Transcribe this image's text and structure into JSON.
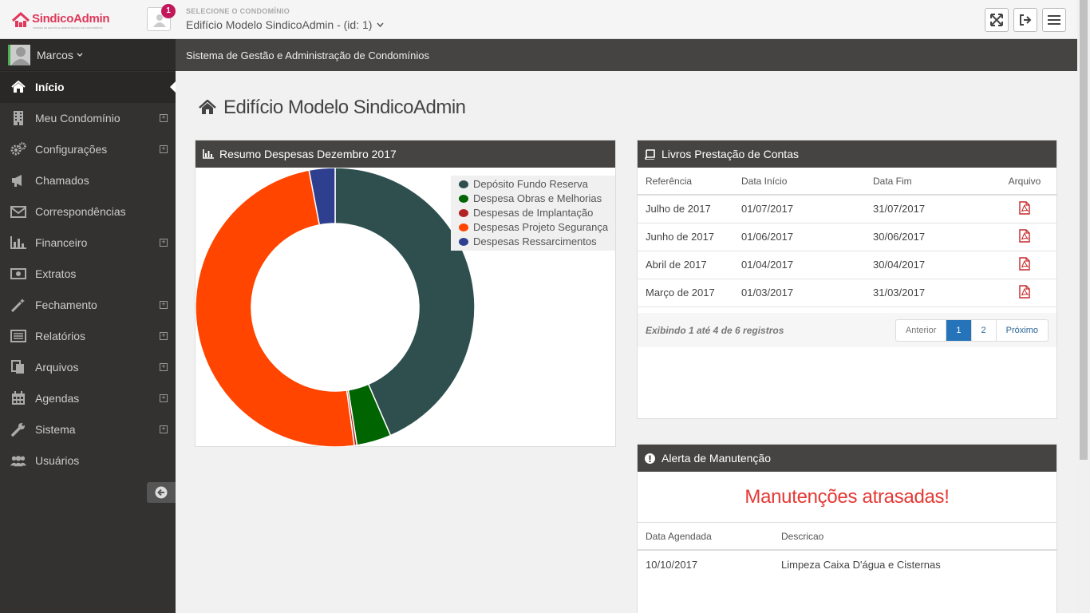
{
  "header": {
    "logo_text": "SindicoAdmin",
    "logo_sub": "SISTEMA DE GESTÃO E ADMINISTRAÇÃO DE CONDOMÍNIOS",
    "notification_count": "1",
    "condo_label": "SELECIONE O CONDOMÍNIO",
    "condo_value": "Edifício Modelo SindicoAdmin - (id: 1)",
    "buttons": [
      "fullscreen-icon",
      "logout-icon",
      "menu-icon"
    ]
  },
  "user": {
    "name": "Marcos"
  },
  "sidebar": {
    "items": [
      {
        "label": "Início",
        "icon": "home-icon",
        "active": true,
        "expandable": false
      },
      {
        "label": "Meu Condomínio",
        "icon": "building-icon",
        "active": false,
        "expandable": true
      },
      {
        "label": "Configurações",
        "icon": "cogs-icon",
        "active": false,
        "expandable": true
      },
      {
        "label": "Chamados",
        "icon": "megaphone-icon",
        "active": false,
        "expandable": false
      },
      {
        "label": "Correspondências",
        "icon": "envelope-icon",
        "active": false,
        "expandable": false
      },
      {
        "label": "Financeiro",
        "icon": "bar-chart-icon",
        "active": false,
        "expandable": true
      },
      {
        "label": "Extratos",
        "icon": "money-icon",
        "active": false,
        "expandable": false
      },
      {
        "label": "Fechamento",
        "icon": "magic-wand-icon",
        "active": false,
        "expandable": true
      },
      {
        "label": "Relatórios",
        "icon": "list-icon",
        "active": false,
        "expandable": true
      },
      {
        "label": "Arquivos",
        "icon": "files-icon",
        "active": false,
        "expandable": true
      },
      {
        "label": "Agendas",
        "icon": "calendar-icon",
        "active": false,
        "expandable": true
      },
      {
        "label": "Sistema",
        "icon": "wrench-icon",
        "active": false,
        "expandable": true
      },
      {
        "label": "Usuários",
        "icon": "users-icon",
        "active": false,
        "expandable": false
      }
    ]
  },
  "breadcrumb": {
    "text": "Sistema de Gestão e Administração de Condomínios"
  },
  "page": {
    "title": "Edifício Modelo SindicoAdmin"
  },
  "expenses_panel": {
    "title": "Resumo Despesas Dezembro 2017"
  },
  "chart_data": {
    "type": "pie",
    "categories": [
      "Depósito Fundo Reserva",
      "Despesa Obras e Melhorias",
      "Despesas de Implantação",
      "Despesas Projeto Segurança",
      "Despesas Ressarcimentos"
    ],
    "values": [
      43.5,
      4.0,
      0.3,
      49.2,
      3.0
    ],
    "colors": [
      "#2f4f4f",
      "#006400",
      "#b22222",
      "#ff4500",
      "#2e3f8f"
    ],
    "legend_position": "top-right"
  },
  "books_panel": {
    "title": "Livros Prestação de Contas",
    "columns": [
      "Referência",
      "Data Início",
      "Data Fim",
      "Arquivo"
    ],
    "rows": [
      [
        "Julho de 2017",
        "01/07/2017",
        "31/07/2017"
      ],
      [
        "Junho de 2017",
        "01/06/2017",
        "30/06/2017"
      ],
      [
        "Abril de 2017",
        "01/04/2017",
        "30/04/2017"
      ],
      [
        "Março de 2017",
        "01/03/2017",
        "31/03/2017"
      ]
    ],
    "records_text": "Exibindo 1 até 4 de 6 registros",
    "pager": {
      "prev": "Anterior",
      "pages": [
        "1",
        "2"
      ],
      "current": "1",
      "next": "Próximo"
    }
  },
  "maintenance_panel": {
    "title": "Alerta de Manutenção",
    "alert": "Manutenções atrasadas!",
    "columns": [
      "Data Agendada",
      "Descricao"
    ],
    "rows": [
      [
        "10/10/2017",
        "Limpeza Caixa D'água e Cisternas"
      ]
    ]
  }
}
